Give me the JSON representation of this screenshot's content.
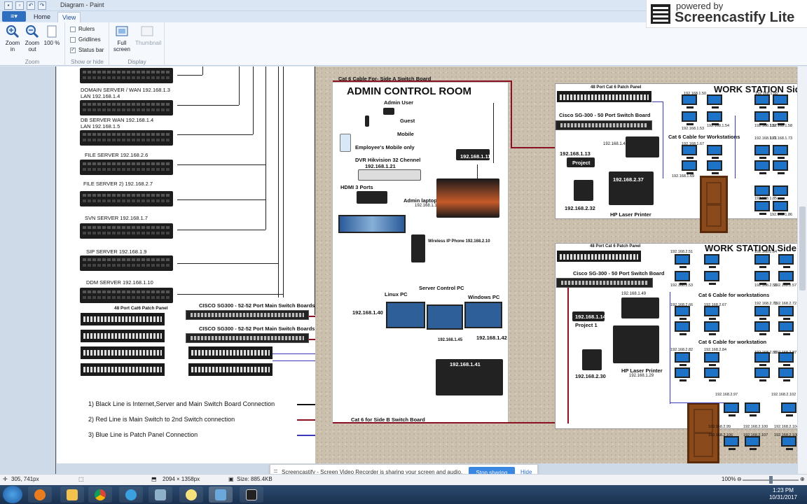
{
  "window": {
    "title": "Diagram - Paint"
  },
  "ribbon": {
    "file_label": "≡▾",
    "tabs": [
      "Home",
      "View"
    ],
    "zoom_in": "Zoom in",
    "zoom_out": "Zoom out",
    "zoom_100": "100 %",
    "zoom_group": "Zoom",
    "rulers": "Rulers",
    "gridlines": "Gridlines",
    "status_bar": "Status bar",
    "show_group": "Show or hide",
    "full_screen": "Full screen",
    "thumbnail": "Thumbnail",
    "display_group": "Display"
  },
  "screencastify": {
    "powered": "powered by",
    "name": "Screencastify Lite",
    "message": "Screencastify - Screen Video Recorder is sharing your screen and audio.",
    "stop": "Stop sharing",
    "hide": "Hide"
  },
  "diagram": {
    "servers": [
      "DOMAIN SERVER / WAN 192.168.1.3\nLAN 192.168.1.4",
      "DB SERVER WAN 192.168.1.4\nLAN 192.168.1.5",
      "FILE SERVER 192.168.2.6",
      "FILE SERVER 2) 192.168.2.7",
      "SVN SERVER 192.168.1.7",
      "SIP SERVER 192.168.1.9",
      "DDM SERVER 192.168.1.10"
    ],
    "patch_panel_label": "48 Port Cat6 Patch Panel",
    "main_switch_1": "CISCO SG300 - 52-52 Port Main Switch Boards",
    "main_switch_2": "CISCO SG300 - 52-52 Port Main Switch Boards",
    "legend": [
      "1) Black Line is Internet,Server and Main Switch Board Connection",
      "2) Red Line is Main Switch to 2nd Switch connection",
      "3) Blue Line is Patch Panel Connection"
    ],
    "admin": {
      "cable_top": "Cat 6 Cable For- Side A Switch Board",
      "title": "ADMIN CONTROL ROOM",
      "admin_user": "Admin User",
      "guest": "Guest",
      "mobile": "Mobile",
      "employee_mobile": "Employee's Mobile only",
      "router_ip": "192.168.1.11",
      "dvr": "DVR Hikvision 32 Chennel",
      "dvr_ip": "192.168.1.21",
      "hdmi": "HDMI 3 Ports",
      "admin_laptop": "Admin laptop",
      "admin_laptop_ip": "192.168.1.100",
      "wireless_phone": "Wireless IP Phone 192.168.2.10",
      "server_control_pc": "Server Control PC",
      "linux_pc": "Linux PC",
      "windows_pc": "Windows PC",
      "linux_ip": "192.168.1.40",
      "server_pc_ip": "192.168.1.45",
      "windows_ip": "192.168.1.42",
      "printer_ip": "192.168.1.41",
      "cable_bottom": "Cat 6 for Side B Switch Board"
    },
    "side_a": {
      "title": "WORK STATION  Sid",
      "patch": "48 Port Cat 6 Patch Panel",
      "switch": "Cisco SG-300 - 50 Port Switch Board",
      "cable": "Cat 6 Cable for  Workstations",
      "project_ip": "192.168.1.13",
      "project": "Project",
      "laptop_ip": "192.168.1.48",
      "printer_ip": "192.168.2.37",
      "printer": "HP Laser Printer",
      "phone_ip": "192.168.2.32",
      "ws_ips": [
        "192.168.1.50",
        "192.168.1.51",
        "192.168.1.52",
        "192.168.1.53",
        "192.168.1.54",
        "192.168.1.55",
        "192.168.1.56",
        "192.168.1.57",
        "192.168.1.58",
        "192.168.1.67",
        "192.168.1.68",
        "192.168.1.69",
        "192.168.1.70",
        "192.168.1.71",
        "192.168.1.72",
        "192.168.1.73",
        "192.168.1.74",
        "192.168.1.83",
        "192.168.1.84",
        "192.168.1.85",
        "192.168.1.86"
      ]
    },
    "side_b": {
      "title": "WORK STATION  Side",
      "patch": "48 Port Cat 6 Patch Panel",
      "switch": "Cisco SG-300 - 50 Port Switch Board",
      "cable1": "Cat 6 Cable for workstations",
      "cable2": "Cat 6 Cable for workstation",
      "project_ip": "192.168.1.14",
      "project": "Project 1",
      "laptop_ip": "192.168.1.49",
      "printer": "HP Laser Printer",
      "printer_ip": "192.168.1.29",
      "phone_ip": "192.168.2.30",
      "ws_ips": [
        "192.168.2.51",
        "192.168.2.52",
        "192.168.2.53",
        "192.168.2.54",
        "192.168.2.55",
        "192.168.2.56",
        "192.168.2.57",
        "192.168.2.66",
        "192.168.2.67",
        "192.168.2.68",
        "192.168.2.69",
        "192.168.2.70",
        "192.168.2.71",
        "192.168.2.72",
        "192.168.2.73",
        "192.168.2.82",
        "192.168.2.83",
        "192.168.2.84",
        "192.168.2.85",
        "192.168.2.86",
        "192.168.2.87",
        "192.168.2.88",
        "192.168.2.97",
        "192.168.2.98",
        "192.168.2.99",
        "192.168.2.100",
        "192.168.2.102",
        "192.168.2.104",
        "192.168.2.106",
        "192.168.2.107",
        "192.168.2.108",
        "192.168.2.109"
      ]
    }
  },
  "status": {
    "cursor": "305, 741px",
    "dims": "2094 × 1358px",
    "size": "Size: 885.4KB",
    "zoom": "100%"
  },
  "taskbar": {
    "time": "1:23 PM",
    "date": "10/31/2017"
  }
}
